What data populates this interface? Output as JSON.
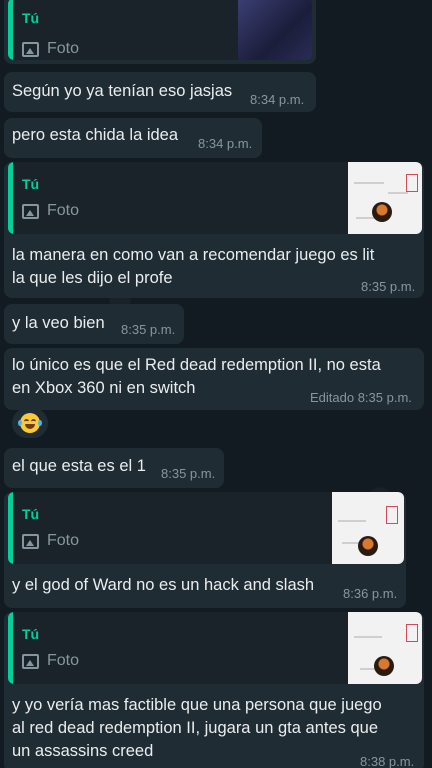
{
  "messages": [
    {
      "quote_author": "Tú",
      "quote_label": "Foto"
    },
    {
      "text": "Según yo ya tenían eso jasjas",
      "time": "8:34 p.m."
    },
    {
      "text": "pero esta chida la idea",
      "time": "8:34 p.m."
    },
    {
      "quote_author": "Tú",
      "quote_label": "Foto",
      "lines": [
        "la manera en como van a recomendar juego es lit",
        "la que les dijo el profe"
      ],
      "time": "8:35 p.m."
    },
    {
      "text": "y la veo bien",
      "time": "8:35 p.m."
    },
    {
      "lines": [
        "lo único es que el Red dead redemption II, no esta",
        "en Xbox 360 ni en switch"
      ],
      "time": "Editado 8:35 p.m.",
      "reaction": "face-with-tears-of-joy-emoji"
    },
    {
      "text": "el que esta es el 1",
      "time": "8:35 p.m."
    },
    {
      "quote_author": "Tú",
      "quote_label": "Foto",
      "text": "y el god of Ward no es un hack and slash",
      "time": "8:36 p.m."
    },
    {
      "quote_author": "Tú",
      "quote_label": "Foto",
      "lines": [
        "y yo vería mas factible que una persona que juego",
        "al red dead redemption II, jugara un gta antes que",
        "un assassins creed"
      ],
      "time": "8:38 p.m."
    }
  ],
  "colors": {
    "bubble": "#202c33",
    "accent": "#06cf9c",
    "text": "#e9edef",
    "meta": "#8696a0",
    "background": "#111b21"
  },
  "icons": [
    "photo-icon",
    "face-with-tears-of-joy-emoji"
  ]
}
